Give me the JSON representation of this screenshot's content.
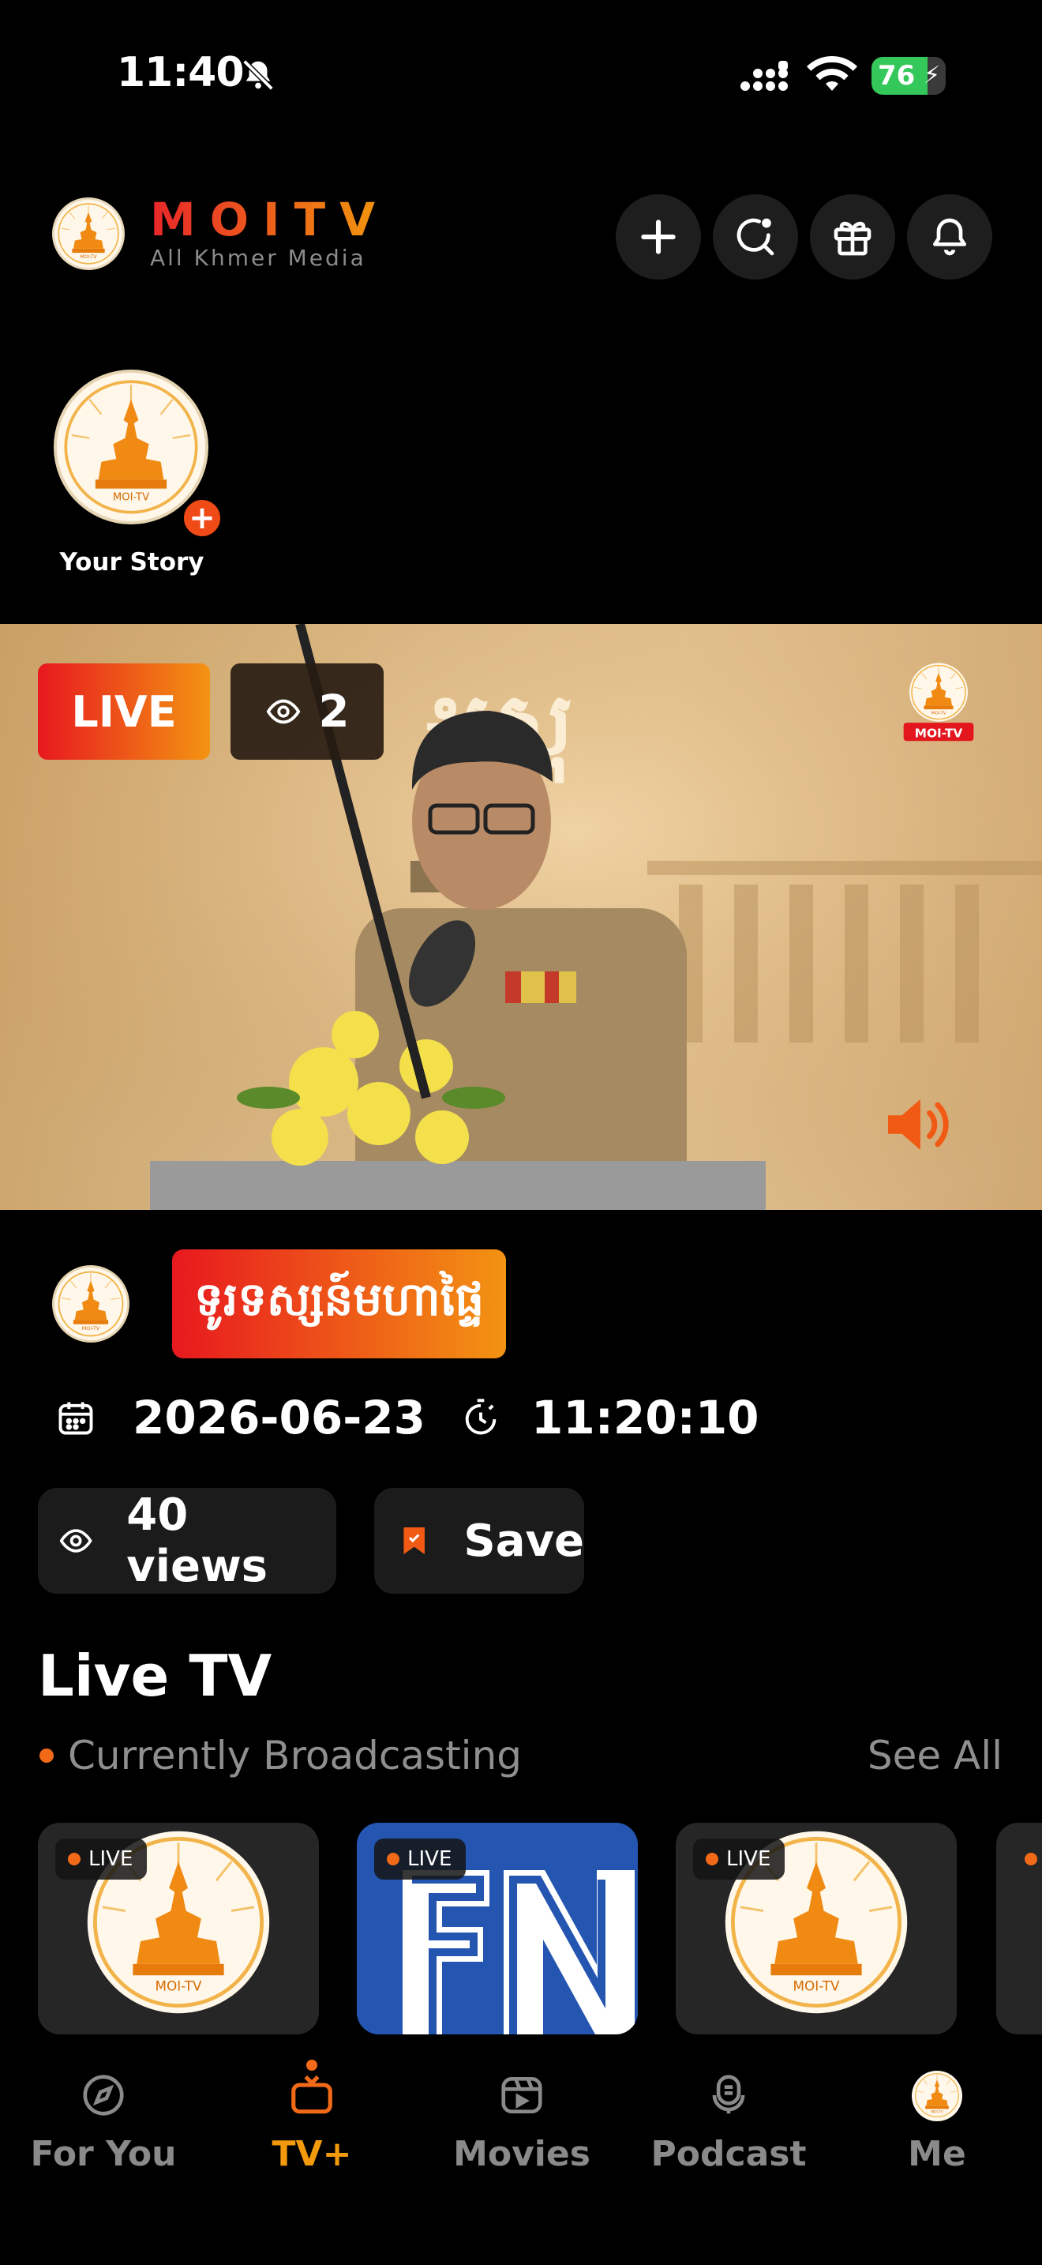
{
  "status_bar": {
    "time": "11:40",
    "battery": "76",
    "battery_level": 0.76
  },
  "header": {
    "brand": "MOITV",
    "tagline": "All Khmer Media",
    "actions": [
      "plus-icon",
      "search-icon",
      "gift-icon",
      "bell-icon"
    ]
  },
  "story": {
    "label": "Your Story"
  },
  "video": {
    "live_label": "LIVE",
    "viewers": "2"
  },
  "channel": {
    "name": "ទូរទស្សន៍មហាផ្ទៃ",
    "date": "2026-06-23",
    "time": "11:20:10",
    "views": "40 views",
    "save_label": "Save"
  },
  "live_tv": {
    "title": "Live TV",
    "subtitle": "Currently Broadcasting",
    "see_all": "See All",
    "cards": [
      {
        "live": "LIVE",
        "logo": "moi-tv-emblem"
      },
      {
        "live": "LIVE",
        "logo": "fn-logo"
      },
      {
        "live": "LIVE",
        "logo": "moi-tv-emblem"
      }
    ]
  },
  "nav": {
    "items": [
      "For You",
      "TV+",
      "Movies",
      "Podcast",
      "Me"
    ],
    "active": "TV+"
  },
  "colors": {
    "accent_red": "#e8181f",
    "accent_orange": "#f39412",
    "background": "#000000"
  }
}
